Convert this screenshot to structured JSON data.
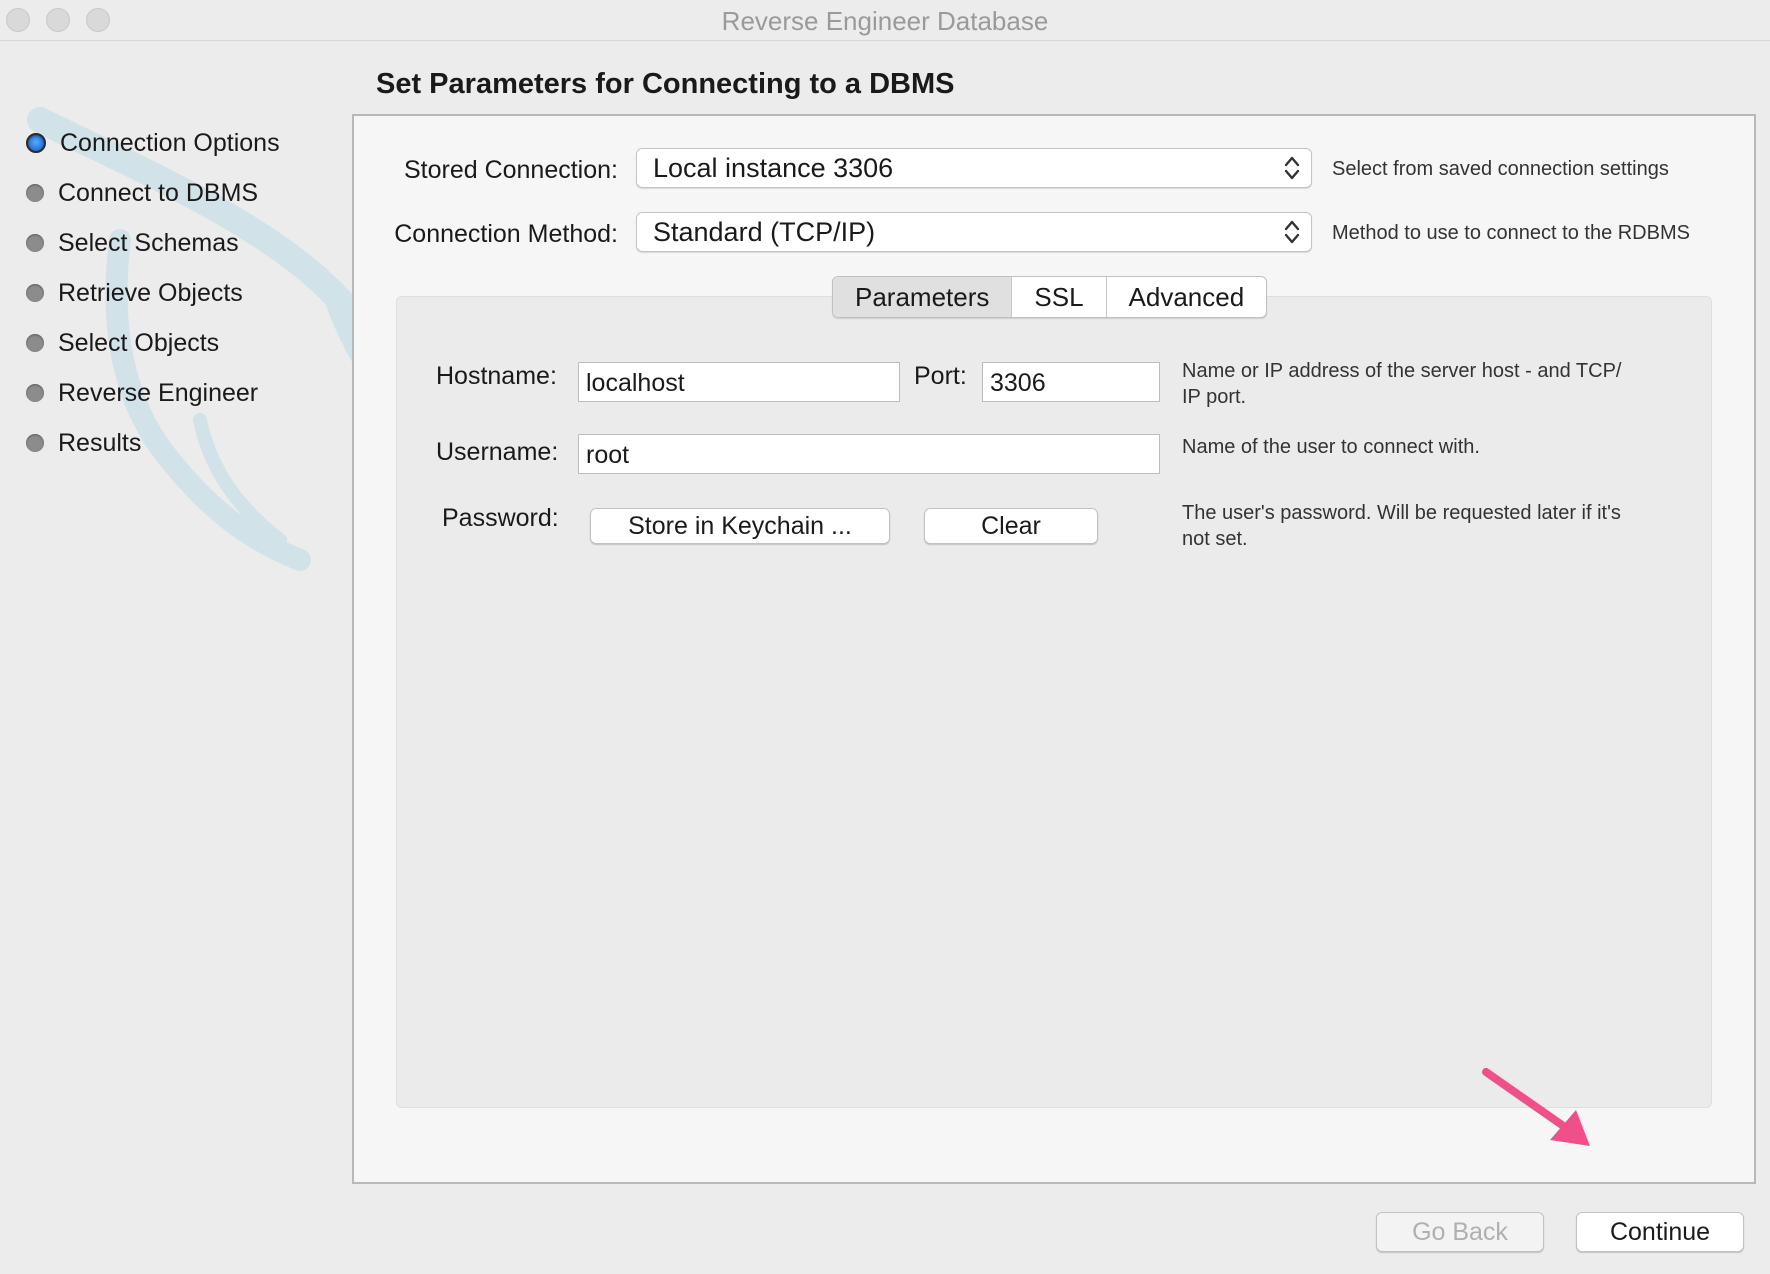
{
  "window": {
    "title": "Reverse Engineer Database"
  },
  "steps": [
    {
      "label": "Connection Options",
      "active": true
    },
    {
      "label": "Connect to DBMS",
      "active": false
    },
    {
      "label": "Select Schemas",
      "active": false
    },
    {
      "label": "Retrieve Objects",
      "active": false
    },
    {
      "label": "Select Objects",
      "active": false
    },
    {
      "label": "Reverse Engineer",
      "active": false
    },
    {
      "label": "Results",
      "active": false
    }
  ],
  "page": {
    "title": "Set Parameters for Connecting to a DBMS"
  },
  "stored_connection": {
    "label": "Stored Connection:",
    "value": "Local instance 3306",
    "hint": "Select from saved connection settings"
  },
  "connection_method": {
    "label": "Connection Method:",
    "value": "Standard (TCP/IP)",
    "hint": "Method to use to connect to the RDBMS"
  },
  "tabs": [
    {
      "label": "Parameters",
      "active": true
    },
    {
      "label": "SSL",
      "active": false
    },
    {
      "label": "Advanced",
      "active": false
    }
  ],
  "params": {
    "hostname_label": "Hostname:",
    "hostname_value": "localhost",
    "port_label": "Port:",
    "port_value": "3306",
    "host_hint_line1": "Name or IP address of the server host - and TCP/",
    "host_hint_line2": "IP port.",
    "username_label": "Username:",
    "username_value": "root",
    "username_hint": "Name of the user to connect with.",
    "password_label": "Password:",
    "store_keychain_label": "Store in Keychain ...",
    "clear_label": "Clear",
    "password_hint_line1": "The user's password. Will be requested later if it's",
    "password_hint_line2": "not set."
  },
  "footer": {
    "go_back_label": "Go Back",
    "continue_label": "Continue"
  },
  "colors": {
    "annotation_arrow": "#f0508a",
    "active_step": "#2d7de0"
  }
}
